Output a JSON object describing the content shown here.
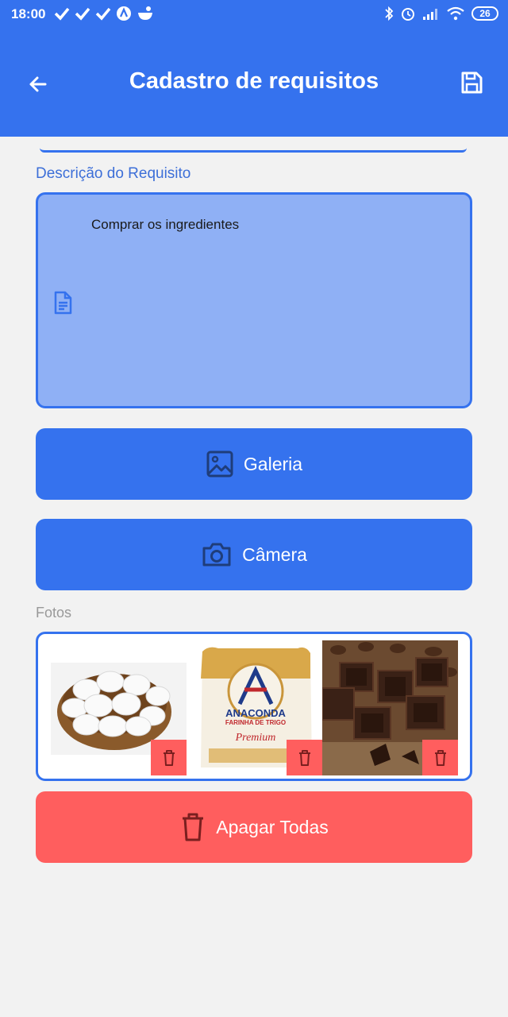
{
  "status_bar": {
    "time": "18:00",
    "battery": "26",
    "left_icons": [
      "check-icon",
      "check-icon",
      "check-icon",
      "app-icon",
      "bowl-icon"
    ],
    "right_icons": [
      "bluetooth-icon",
      "alarm-icon",
      "signal-icon",
      "wifi-icon",
      "battery-icon"
    ]
  },
  "appbar": {
    "title": "Cadastro de requisitos",
    "back_icon": "arrow-left-icon",
    "save_icon": "save-icon"
  },
  "description": {
    "label": "Descrição do Requisito",
    "value": "Comprar os ingredientes",
    "icon": "document-icon"
  },
  "buttons": {
    "gallery": "Galeria",
    "camera": "Câmera",
    "delete_all": "Apagar Todas"
  },
  "photos": {
    "label": "Fotos",
    "items": [
      {
        "subject": "eggs-in-basket",
        "delete_icon": "trash-icon"
      },
      {
        "subject": "flour-bag",
        "delete_icon": "trash-icon",
        "brand": "ANACONDA",
        "subtitle": "FARINHA DE TRIGO",
        "badge": "Premium"
      },
      {
        "subject": "chocolate-pieces",
        "delete_icon": "trash-icon"
      }
    ]
  },
  "colors": {
    "primary": "#3572ee",
    "field_fill": "#8fb0f5",
    "danger": "#ff5e5e",
    "background": "#f2f2f2"
  }
}
